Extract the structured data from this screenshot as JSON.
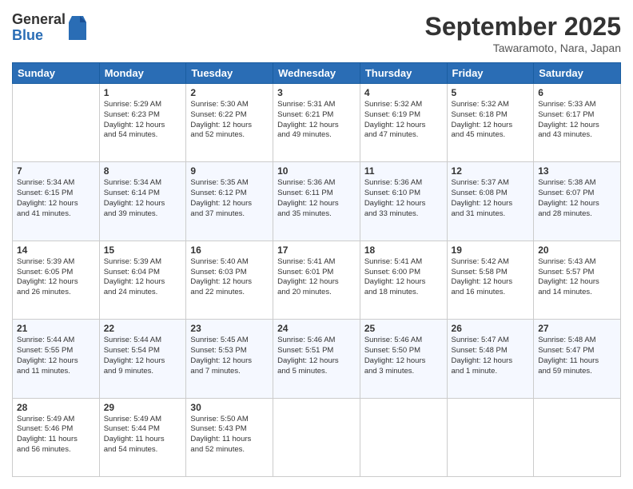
{
  "logo": {
    "general": "General",
    "blue": "Blue"
  },
  "title": "September 2025",
  "location": "Tawaramoto, Nara, Japan",
  "days_of_week": [
    "Sunday",
    "Monday",
    "Tuesday",
    "Wednesday",
    "Thursday",
    "Friday",
    "Saturday"
  ],
  "weeks": [
    [
      {
        "day": "",
        "info": ""
      },
      {
        "day": "1",
        "info": "Sunrise: 5:29 AM\nSunset: 6:23 PM\nDaylight: 12 hours\nand 54 minutes."
      },
      {
        "day": "2",
        "info": "Sunrise: 5:30 AM\nSunset: 6:22 PM\nDaylight: 12 hours\nand 52 minutes."
      },
      {
        "day": "3",
        "info": "Sunrise: 5:31 AM\nSunset: 6:21 PM\nDaylight: 12 hours\nand 49 minutes."
      },
      {
        "day": "4",
        "info": "Sunrise: 5:32 AM\nSunset: 6:19 PM\nDaylight: 12 hours\nand 47 minutes."
      },
      {
        "day": "5",
        "info": "Sunrise: 5:32 AM\nSunset: 6:18 PM\nDaylight: 12 hours\nand 45 minutes."
      },
      {
        "day": "6",
        "info": "Sunrise: 5:33 AM\nSunset: 6:17 PM\nDaylight: 12 hours\nand 43 minutes."
      }
    ],
    [
      {
        "day": "7",
        "info": "Sunrise: 5:34 AM\nSunset: 6:15 PM\nDaylight: 12 hours\nand 41 minutes."
      },
      {
        "day": "8",
        "info": "Sunrise: 5:34 AM\nSunset: 6:14 PM\nDaylight: 12 hours\nand 39 minutes."
      },
      {
        "day": "9",
        "info": "Sunrise: 5:35 AM\nSunset: 6:12 PM\nDaylight: 12 hours\nand 37 minutes."
      },
      {
        "day": "10",
        "info": "Sunrise: 5:36 AM\nSunset: 6:11 PM\nDaylight: 12 hours\nand 35 minutes."
      },
      {
        "day": "11",
        "info": "Sunrise: 5:36 AM\nSunset: 6:10 PM\nDaylight: 12 hours\nand 33 minutes."
      },
      {
        "day": "12",
        "info": "Sunrise: 5:37 AM\nSunset: 6:08 PM\nDaylight: 12 hours\nand 31 minutes."
      },
      {
        "day": "13",
        "info": "Sunrise: 5:38 AM\nSunset: 6:07 PM\nDaylight: 12 hours\nand 28 minutes."
      }
    ],
    [
      {
        "day": "14",
        "info": "Sunrise: 5:39 AM\nSunset: 6:05 PM\nDaylight: 12 hours\nand 26 minutes."
      },
      {
        "day": "15",
        "info": "Sunrise: 5:39 AM\nSunset: 6:04 PM\nDaylight: 12 hours\nand 24 minutes."
      },
      {
        "day": "16",
        "info": "Sunrise: 5:40 AM\nSunset: 6:03 PM\nDaylight: 12 hours\nand 22 minutes."
      },
      {
        "day": "17",
        "info": "Sunrise: 5:41 AM\nSunset: 6:01 PM\nDaylight: 12 hours\nand 20 minutes."
      },
      {
        "day": "18",
        "info": "Sunrise: 5:41 AM\nSunset: 6:00 PM\nDaylight: 12 hours\nand 18 minutes."
      },
      {
        "day": "19",
        "info": "Sunrise: 5:42 AM\nSunset: 5:58 PM\nDaylight: 12 hours\nand 16 minutes."
      },
      {
        "day": "20",
        "info": "Sunrise: 5:43 AM\nSunset: 5:57 PM\nDaylight: 12 hours\nand 14 minutes."
      }
    ],
    [
      {
        "day": "21",
        "info": "Sunrise: 5:44 AM\nSunset: 5:55 PM\nDaylight: 12 hours\nand 11 minutes."
      },
      {
        "day": "22",
        "info": "Sunrise: 5:44 AM\nSunset: 5:54 PM\nDaylight: 12 hours\nand 9 minutes."
      },
      {
        "day": "23",
        "info": "Sunrise: 5:45 AM\nSunset: 5:53 PM\nDaylight: 12 hours\nand 7 minutes."
      },
      {
        "day": "24",
        "info": "Sunrise: 5:46 AM\nSunset: 5:51 PM\nDaylight: 12 hours\nand 5 minutes."
      },
      {
        "day": "25",
        "info": "Sunrise: 5:46 AM\nSunset: 5:50 PM\nDaylight: 12 hours\nand 3 minutes."
      },
      {
        "day": "26",
        "info": "Sunrise: 5:47 AM\nSunset: 5:48 PM\nDaylight: 12 hours\nand 1 minute."
      },
      {
        "day": "27",
        "info": "Sunrise: 5:48 AM\nSunset: 5:47 PM\nDaylight: 11 hours\nand 59 minutes."
      }
    ],
    [
      {
        "day": "28",
        "info": "Sunrise: 5:49 AM\nSunset: 5:46 PM\nDaylight: 11 hours\nand 56 minutes."
      },
      {
        "day": "29",
        "info": "Sunrise: 5:49 AM\nSunset: 5:44 PM\nDaylight: 11 hours\nand 54 minutes."
      },
      {
        "day": "30",
        "info": "Sunrise: 5:50 AM\nSunset: 5:43 PM\nDaylight: 11 hours\nand 52 minutes."
      },
      {
        "day": "",
        "info": ""
      },
      {
        "day": "",
        "info": ""
      },
      {
        "day": "",
        "info": ""
      },
      {
        "day": "",
        "info": ""
      }
    ]
  ]
}
